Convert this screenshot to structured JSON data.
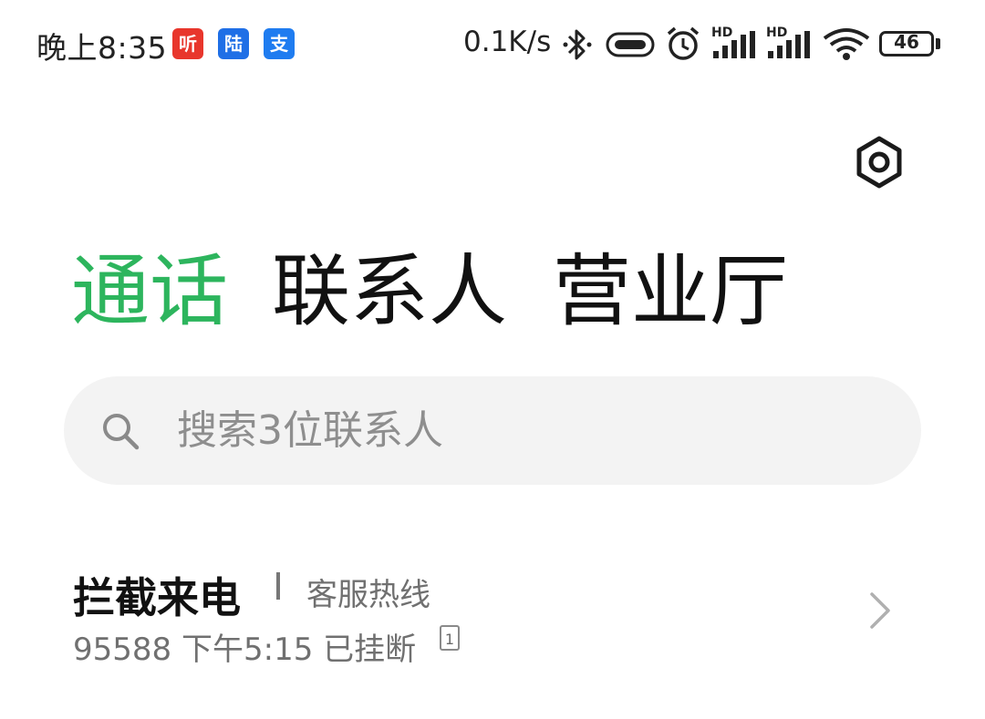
{
  "status_bar": {
    "time": "晚上8:35",
    "apps": [
      {
        "name": "ting-app-icon",
        "glyph": "听"
      },
      {
        "name": "lu-app-icon",
        "glyph": "陆"
      },
      {
        "name": "alipay-app-icon",
        "glyph": "支"
      }
    ],
    "network_speed": "0.1K/s",
    "signal_label_1": "HD",
    "signal_label_2": "HD",
    "battery": "46",
    "battery_level": 0.46
  },
  "tabs": [
    {
      "label": "通话",
      "active": true
    },
    {
      "label": "联系人",
      "active": false
    },
    {
      "label": "营业厅",
      "active": false
    }
  ],
  "search": {
    "placeholder": "搜索3位联系人"
  },
  "call_log": [
    {
      "title": "拦截来电",
      "tag": "客服热线",
      "number": "95588",
      "time": "下午5:15",
      "status": "已挂断",
      "sim": "1"
    }
  ],
  "colors": {
    "accent": "#2db55d",
    "text_primary": "#111111",
    "text_secondary": "#707070",
    "search_bg": "#f3f3f3"
  }
}
